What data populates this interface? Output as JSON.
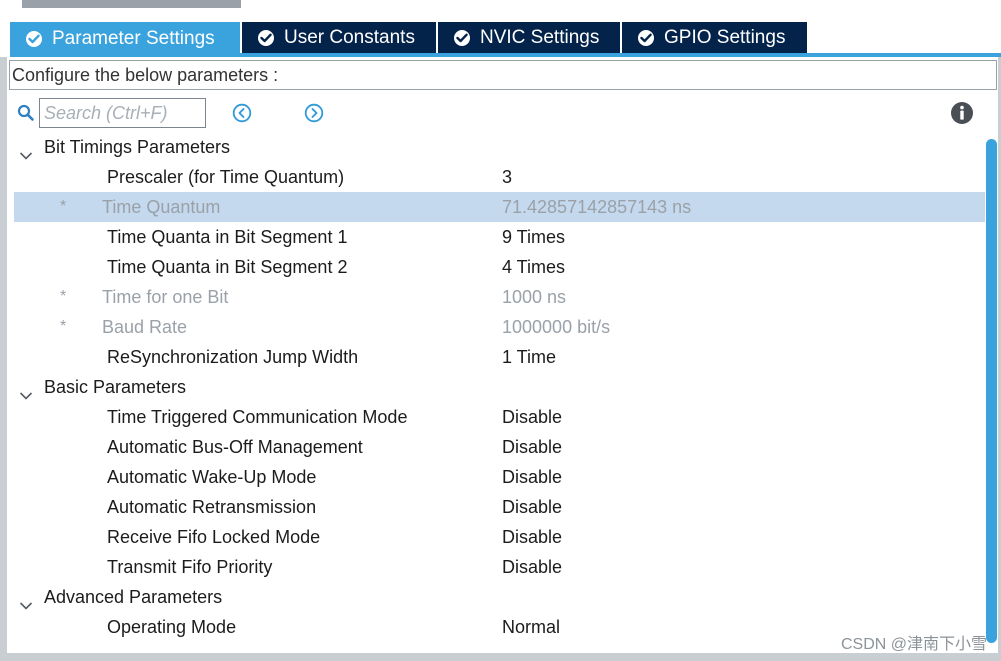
{
  "tabs": [
    {
      "label": "Parameter Settings",
      "active": true
    },
    {
      "label": "User Constants",
      "active": false
    },
    {
      "label": "NVIC Settings",
      "active": false
    },
    {
      "label": "GPIO Settings",
      "active": false
    }
  ],
  "configure_text": "Configure the below parameters :",
  "search": {
    "placeholder": "Search (Ctrl+F)",
    "value": ""
  },
  "icons": {
    "search": "search-icon",
    "prev": "chevron-left-circle-icon",
    "next": "chevron-right-circle-icon",
    "info": "info-icon",
    "tab_status": "check-circle-icon",
    "group_toggle": "chevron-down-icon"
  },
  "groups": [
    {
      "name": "Bit Timings Parameters",
      "params": [
        {
          "name": "Prescaler (for Time Quantum)",
          "value": "3",
          "readonly": false,
          "selected": false
        },
        {
          "name": "Time Quantum",
          "value": "71.42857142857143 ns",
          "readonly": true,
          "selected": true
        },
        {
          "name": "Time Quanta in Bit Segment 1",
          "value": "9 Times",
          "readonly": false,
          "selected": false
        },
        {
          "name": "Time Quanta in Bit Segment 2",
          "value": "4 Times",
          "readonly": false,
          "selected": false
        },
        {
          "name": "Time for one Bit",
          "value": "1000 ns",
          "readonly": true,
          "selected": false
        },
        {
          "name": "Baud Rate",
          "value": "1000000 bit/s",
          "readonly": true,
          "selected": false
        },
        {
          "name": "ReSynchronization Jump Width",
          "value": "1 Time",
          "readonly": false,
          "selected": false
        }
      ]
    },
    {
      "name": "Basic Parameters",
      "params": [
        {
          "name": "Time Triggered Communication Mode",
          "value": "Disable",
          "readonly": false,
          "selected": false
        },
        {
          "name": "Automatic Bus-Off Management",
          "value": "Disable",
          "readonly": false,
          "selected": false
        },
        {
          "name": "Automatic Wake-Up Mode",
          "value": "Disable",
          "readonly": false,
          "selected": false
        },
        {
          "name": "Automatic Retransmission",
          "value": "Disable",
          "readonly": false,
          "selected": false
        },
        {
          "name": "Receive Fifo Locked Mode",
          "value": "Disable",
          "readonly": false,
          "selected": false
        },
        {
          "name": "Transmit Fifo Priority",
          "value": "Disable",
          "readonly": false,
          "selected": false
        }
      ]
    },
    {
      "name": "Advanced Parameters",
      "params": [
        {
          "name": "Operating Mode",
          "value": "Normal",
          "readonly": false,
          "selected": false
        }
      ]
    }
  ],
  "readonly_marker": "*",
  "watermark": "CSDN @津南下小雪",
  "colors": {
    "tab_bg": "#03234b",
    "tab_active_bg": "#3aa3de",
    "selected_row_bg": "#c4d8ee",
    "readonly_text": "#9aa1a8",
    "accent": "#3aa3de"
  }
}
